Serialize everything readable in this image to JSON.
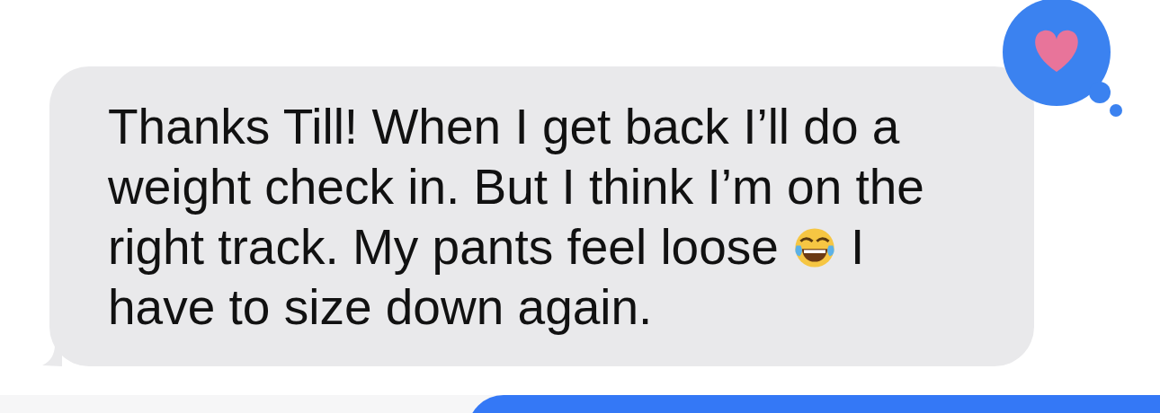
{
  "message": {
    "lines": [
      [
        {
          "kind": "text",
          "text": "Thanks Till! When I get back I’ll do a"
        }
      ],
      [
        {
          "kind": "text",
          "text": "weight check in. But I think I’m on the"
        }
      ],
      [
        {
          "kind": "text",
          "text": "right track. My pants feel loose"
        },
        {
          "kind": "emoji"
        },
        {
          "kind": "text",
          "text": "I"
        }
      ],
      [
        {
          "kind": "text",
          "text": "have to size down again."
        }
      ]
    ]
  },
  "reaction": {
    "kind": "heart"
  }
}
